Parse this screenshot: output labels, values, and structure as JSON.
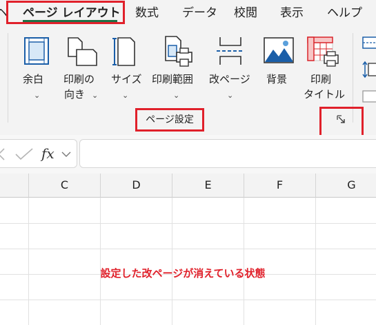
{
  "tabs": {
    "partial_left": "ヘ",
    "active": "ページ レイアウト",
    "items": [
      "数式",
      "データ",
      "校閲",
      "表示",
      "ヘルプ"
    ]
  },
  "ribbon": {
    "buttons": {
      "margins": "余白",
      "orientation_line1": "印刷の",
      "orientation_line2": "向き",
      "size": "サイズ",
      "print_area": "印刷範囲",
      "breaks": "改ページ",
      "background": "背景",
      "print_titles_line1": "印刷",
      "print_titles_line2": "タイトル"
    },
    "group_label": "ページ設定"
  },
  "formula_bar": {
    "fx": "fx"
  },
  "grid": {
    "columns": [
      "C",
      "D",
      "E",
      "F",
      "G"
    ]
  },
  "annotation": "設定した改ページが消えている状態",
  "colors": {
    "highlight": "#e0202a",
    "tab_underline": "#1e7145",
    "ribbon_bg": "#f3f3f3"
  }
}
